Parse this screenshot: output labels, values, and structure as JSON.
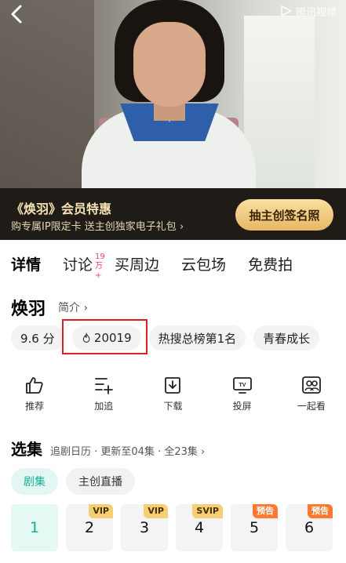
{
  "header": {
    "back_icon": "chevron-left-icon",
    "brand_text": "腾讯视频"
  },
  "promo": {
    "title": "《焕羽》会员特惠",
    "subtitle": "购专属IP限定卡 送主创独家电子礼包 ›",
    "cta": "抽主创签名照"
  },
  "tabs": [
    {
      "label": "详情",
      "active": true
    },
    {
      "label": "讨论",
      "badge": "19万+"
    },
    {
      "label": "买周边"
    },
    {
      "label": "云包场"
    },
    {
      "label": "免费拍"
    }
  ],
  "show": {
    "title": "焕羽",
    "intro_label": "简介 ›"
  },
  "chips": {
    "score": "9.6 分",
    "heat": "20019",
    "rank": "热搜总榜第1名",
    "tag": "青春成长"
  },
  "actions": [
    {
      "label": "推荐",
      "icon": "thumbs-up-icon"
    },
    {
      "label": "加追",
      "icon": "list-add-icon"
    },
    {
      "label": "下载",
      "icon": "download-icon"
    },
    {
      "label": "投屏",
      "icon": "tv-cast-icon"
    },
    {
      "label": "一起看",
      "icon": "watch-together-icon"
    }
  ],
  "episodes_section": {
    "title": "选集",
    "meta": "追剧日历 · 更新至04集 · 全23集 ›",
    "subtabs": [
      {
        "label": "剧集",
        "active": true
      },
      {
        "label": "主创直播"
      }
    ],
    "items": [
      {
        "number": "1",
        "active": true
      },
      {
        "number": "2",
        "badge": "VIP"
      },
      {
        "number": "3",
        "badge": "VIP"
      },
      {
        "number": "4",
        "badge": "SVIP"
      },
      {
        "number": "5",
        "badge": "预告"
      },
      {
        "number": "6",
        "badge": "预告"
      }
    ]
  },
  "colors": {
    "accent": "#17b097",
    "promo_bg": "#1f1b16",
    "highlight": "#e02020"
  }
}
